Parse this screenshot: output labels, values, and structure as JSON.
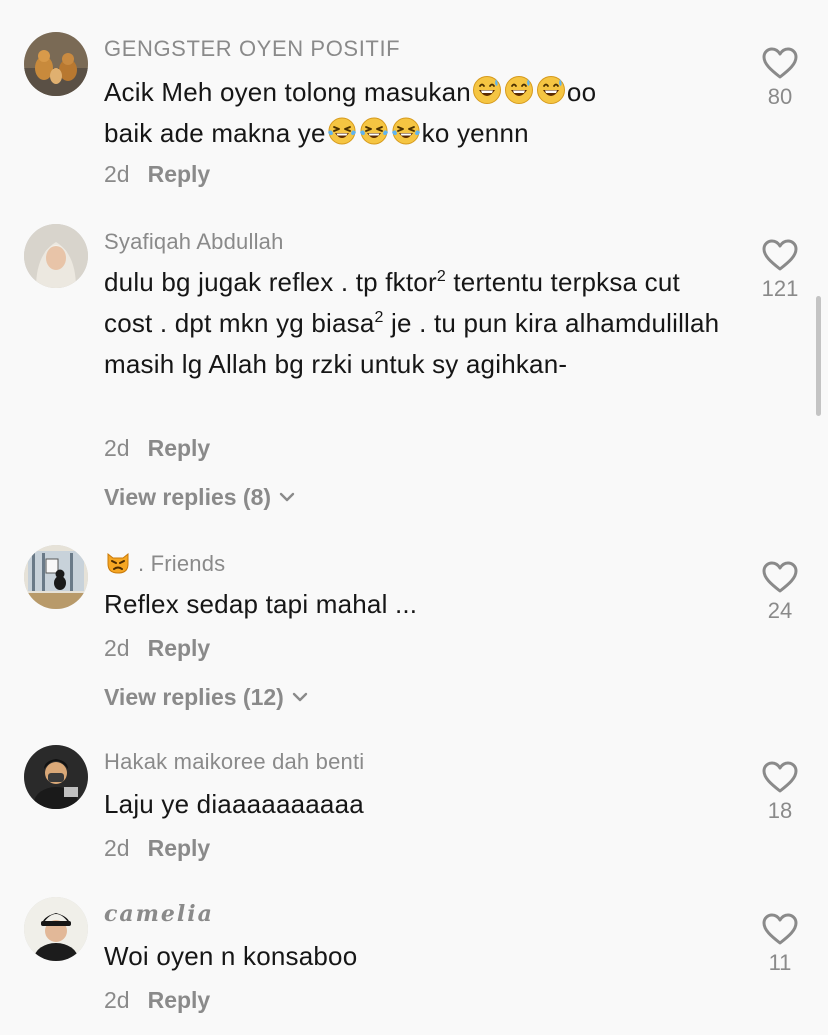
{
  "comments": [
    {
      "username": "GENGSTER OYEN POSITIF",
      "text_line1_a": "Acik Meh oyen tolong masukan",
      "text_line1_b": "oo",
      "text_line2_a": "baik ade makna ye",
      "text_line2_b": "ko yennn",
      "time": "2d",
      "reply": "Reply",
      "likes": "80"
    },
    {
      "username": "Syafiqah Abdullah",
      "text_a": "dulu bg jugak reflex . tp fktor",
      "sup1": "2",
      "text_b": " tertentu terpksa cut cost . dpt mkn yg biasa",
      "sup2": "2",
      "text_c": " je . tu pun kira alhamdulillah masih lg Allah bg rzki untuk sy agihkan-",
      "time": "2d",
      "reply": "Reply",
      "view_replies": "View replies (8)",
      "likes": "121"
    },
    {
      "username": ". Friends",
      "text": "Reflex sedap tapi mahal ...",
      "time": "2d",
      "reply": "Reply",
      "view_replies": "View replies (12)",
      "likes": "24"
    },
    {
      "username": "Hakak maikoree dah benti",
      "text": "Laju ye diaaaaaaaaaa",
      "time": "2d",
      "reply": "Reply",
      "likes": "18"
    },
    {
      "username": "camelia",
      "text": "Woi oyen n konsaboo",
      "time": "2d",
      "reply": "Reply",
      "likes": "11"
    }
  ],
  "icons": {
    "like": "heart-outline-icon",
    "expand": "chevron-down-icon",
    "emoji_sweat": "grinning-sweat-emoji",
    "emoji_tears": "tears-of-joy-emoji",
    "emoji_cat": "pouting-cat-emoji"
  },
  "colors": {
    "background": "#f9f9f9",
    "text": "#161616",
    "muted": "#8a8a8a"
  }
}
